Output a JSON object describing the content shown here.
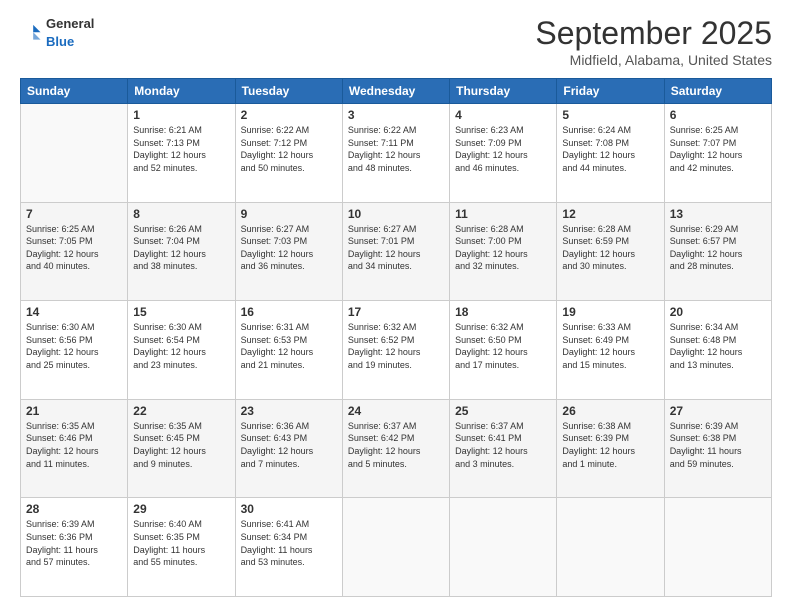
{
  "header": {
    "logo": {
      "general": "General",
      "blue": "Blue"
    },
    "title": "September 2025",
    "location": "Midfield, Alabama, United States"
  },
  "weekdays": [
    "Sunday",
    "Monday",
    "Tuesday",
    "Wednesday",
    "Thursday",
    "Friday",
    "Saturday"
  ],
  "weeks": [
    [
      {
        "day": "",
        "info": ""
      },
      {
        "day": "1",
        "info": "Sunrise: 6:21 AM\nSunset: 7:13 PM\nDaylight: 12 hours\nand 52 minutes."
      },
      {
        "day": "2",
        "info": "Sunrise: 6:22 AM\nSunset: 7:12 PM\nDaylight: 12 hours\nand 50 minutes."
      },
      {
        "day": "3",
        "info": "Sunrise: 6:22 AM\nSunset: 7:11 PM\nDaylight: 12 hours\nand 48 minutes."
      },
      {
        "day": "4",
        "info": "Sunrise: 6:23 AM\nSunset: 7:09 PM\nDaylight: 12 hours\nand 46 minutes."
      },
      {
        "day": "5",
        "info": "Sunrise: 6:24 AM\nSunset: 7:08 PM\nDaylight: 12 hours\nand 44 minutes."
      },
      {
        "day": "6",
        "info": "Sunrise: 6:25 AM\nSunset: 7:07 PM\nDaylight: 12 hours\nand 42 minutes."
      }
    ],
    [
      {
        "day": "7",
        "info": "Sunrise: 6:25 AM\nSunset: 7:05 PM\nDaylight: 12 hours\nand 40 minutes."
      },
      {
        "day": "8",
        "info": "Sunrise: 6:26 AM\nSunset: 7:04 PM\nDaylight: 12 hours\nand 38 minutes."
      },
      {
        "day": "9",
        "info": "Sunrise: 6:27 AM\nSunset: 7:03 PM\nDaylight: 12 hours\nand 36 minutes."
      },
      {
        "day": "10",
        "info": "Sunrise: 6:27 AM\nSunset: 7:01 PM\nDaylight: 12 hours\nand 34 minutes."
      },
      {
        "day": "11",
        "info": "Sunrise: 6:28 AM\nSunset: 7:00 PM\nDaylight: 12 hours\nand 32 minutes."
      },
      {
        "day": "12",
        "info": "Sunrise: 6:28 AM\nSunset: 6:59 PM\nDaylight: 12 hours\nand 30 minutes."
      },
      {
        "day": "13",
        "info": "Sunrise: 6:29 AM\nSunset: 6:57 PM\nDaylight: 12 hours\nand 28 minutes."
      }
    ],
    [
      {
        "day": "14",
        "info": "Sunrise: 6:30 AM\nSunset: 6:56 PM\nDaylight: 12 hours\nand 25 minutes."
      },
      {
        "day": "15",
        "info": "Sunrise: 6:30 AM\nSunset: 6:54 PM\nDaylight: 12 hours\nand 23 minutes."
      },
      {
        "day": "16",
        "info": "Sunrise: 6:31 AM\nSunset: 6:53 PM\nDaylight: 12 hours\nand 21 minutes."
      },
      {
        "day": "17",
        "info": "Sunrise: 6:32 AM\nSunset: 6:52 PM\nDaylight: 12 hours\nand 19 minutes."
      },
      {
        "day": "18",
        "info": "Sunrise: 6:32 AM\nSunset: 6:50 PM\nDaylight: 12 hours\nand 17 minutes."
      },
      {
        "day": "19",
        "info": "Sunrise: 6:33 AM\nSunset: 6:49 PM\nDaylight: 12 hours\nand 15 minutes."
      },
      {
        "day": "20",
        "info": "Sunrise: 6:34 AM\nSunset: 6:48 PM\nDaylight: 12 hours\nand 13 minutes."
      }
    ],
    [
      {
        "day": "21",
        "info": "Sunrise: 6:35 AM\nSunset: 6:46 PM\nDaylight: 12 hours\nand 11 minutes."
      },
      {
        "day": "22",
        "info": "Sunrise: 6:35 AM\nSunset: 6:45 PM\nDaylight: 12 hours\nand 9 minutes."
      },
      {
        "day": "23",
        "info": "Sunrise: 6:36 AM\nSunset: 6:43 PM\nDaylight: 12 hours\nand 7 minutes."
      },
      {
        "day": "24",
        "info": "Sunrise: 6:37 AM\nSunset: 6:42 PM\nDaylight: 12 hours\nand 5 minutes."
      },
      {
        "day": "25",
        "info": "Sunrise: 6:37 AM\nSunset: 6:41 PM\nDaylight: 12 hours\nand 3 minutes."
      },
      {
        "day": "26",
        "info": "Sunrise: 6:38 AM\nSunset: 6:39 PM\nDaylight: 12 hours\nand 1 minute."
      },
      {
        "day": "27",
        "info": "Sunrise: 6:39 AM\nSunset: 6:38 PM\nDaylight: 11 hours\nand 59 minutes."
      }
    ],
    [
      {
        "day": "28",
        "info": "Sunrise: 6:39 AM\nSunset: 6:36 PM\nDaylight: 11 hours\nand 57 minutes."
      },
      {
        "day": "29",
        "info": "Sunrise: 6:40 AM\nSunset: 6:35 PM\nDaylight: 11 hours\nand 55 minutes."
      },
      {
        "day": "30",
        "info": "Sunrise: 6:41 AM\nSunset: 6:34 PM\nDaylight: 11 hours\nand 53 minutes."
      },
      {
        "day": "",
        "info": ""
      },
      {
        "day": "",
        "info": ""
      },
      {
        "day": "",
        "info": ""
      },
      {
        "day": "",
        "info": ""
      }
    ]
  ]
}
